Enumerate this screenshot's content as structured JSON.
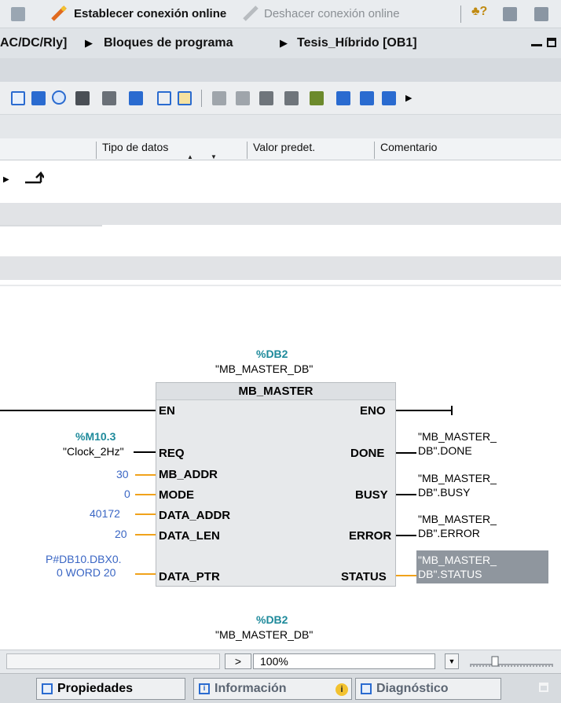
{
  "toolbar_top": {
    "connect_label": "Establecer conexión online",
    "disconnect_label": "Deshacer conexión online"
  },
  "breadcrumb": {
    "part1": "AC/DC/Rly]",
    "part2": "Bloques de programa",
    "part3": "Tesis_Híbrido [OB1]"
  },
  "interface_header": {
    "col_type": "Tipo de datos",
    "col_default": "Valor predet.",
    "col_comment": "Comentario"
  },
  "block": {
    "db_address": "%DB2",
    "db_name": "\"MB_MASTER_DB\"",
    "title": "MB_MASTER",
    "inputs": [
      {
        "pin": "EN",
        "addr": "",
        "value": ""
      },
      {
        "pin": "REQ",
        "addr": "%M10.3",
        "value": "\"Clock_2Hz\""
      },
      {
        "pin": "MB_ADDR",
        "value": "30"
      },
      {
        "pin": "MODE",
        "value": "0"
      },
      {
        "pin": "DATA_ADDR",
        "value": "40172"
      },
      {
        "pin": "DATA_LEN",
        "value": "20"
      },
      {
        "pin": "DATA_PTR",
        "value1": "P#DB10.DBX0.",
        "value2": "0 WORD 20"
      }
    ],
    "outputs": [
      {
        "pin": "ENO"
      },
      {
        "pin": "DONE",
        "line1": "\"MB_MASTER_",
        "line2": "DB\".DONE"
      },
      {
        "pin": "BUSY",
        "line1": "\"MB_MASTER_",
        "line2": "DB\".BUSY"
      },
      {
        "pin": "ERROR",
        "line1": "\"MB_MASTER_",
        "line2": "DB\".ERROR"
      },
      {
        "pin": "STATUS",
        "line1": "\"MB_MASTER_",
        "line2": "DB\".STATUS"
      }
    ]
  },
  "next_block": {
    "db_address": "%DB2",
    "db_name": "\"MB_MASTER_DB\""
  },
  "status_bar": {
    "zoom": "100%"
  },
  "bottom_tabs": {
    "properties": "Propiedades",
    "info": "Información",
    "diagnostics": "Diagnóstico"
  },
  "colors": {
    "accent_blue": "#3a66c4",
    "teal": "#1e8a9b",
    "orange_wire": "#f0a21b",
    "selection_grey": "#8f969e"
  }
}
